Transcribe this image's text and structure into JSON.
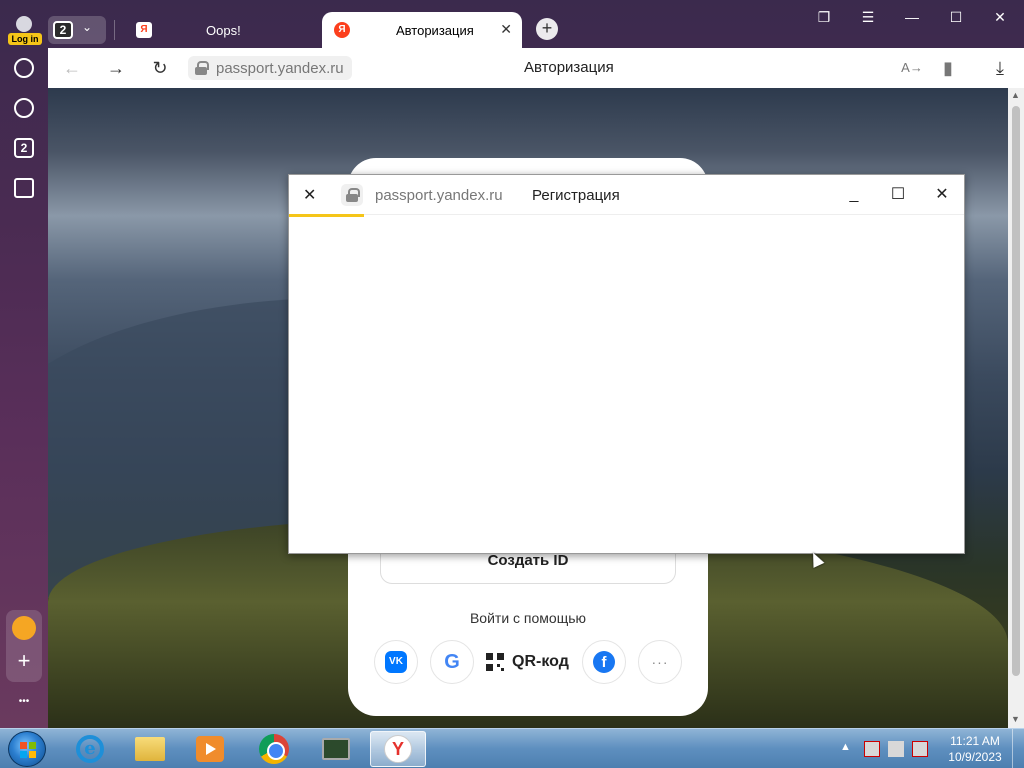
{
  "sidebar": {
    "login_badge": "Log in",
    "tabs_count_icon": "2",
    "more": "•••",
    "plus": "+"
  },
  "tabs": {
    "count": "2",
    "items": [
      {
        "title": "Oops!"
      },
      {
        "title": "Авторизация",
        "favicon": "Я"
      }
    ],
    "new_tab": "+"
  },
  "addressbar": {
    "url": "passport.yandex.ru",
    "title": "Авторизация"
  },
  "login_card": {
    "create_id": "Создать ID",
    "login_with": "Войти с помощью",
    "vk": "VK",
    "google": "G",
    "qr": "QR-код",
    "facebook": "f",
    "more": "···"
  },
  "popup": {
    "url": "passport.yandex.ru",
    "title": "Регистрация"
  },
  "taskbar": {
    "time": "11:21 AM",
    "date": "10/9/2023",
    "yabrowser_letter": "Y",
    "ie_letter": "e"
  },
  "colors": {
    "yandex_red": "#fc3f1d",
    "yandex_yellow": "#f5c518",
    "vk_blue": "#0077ff",
    "facebook_blue": "#1877f2"
  }
}
